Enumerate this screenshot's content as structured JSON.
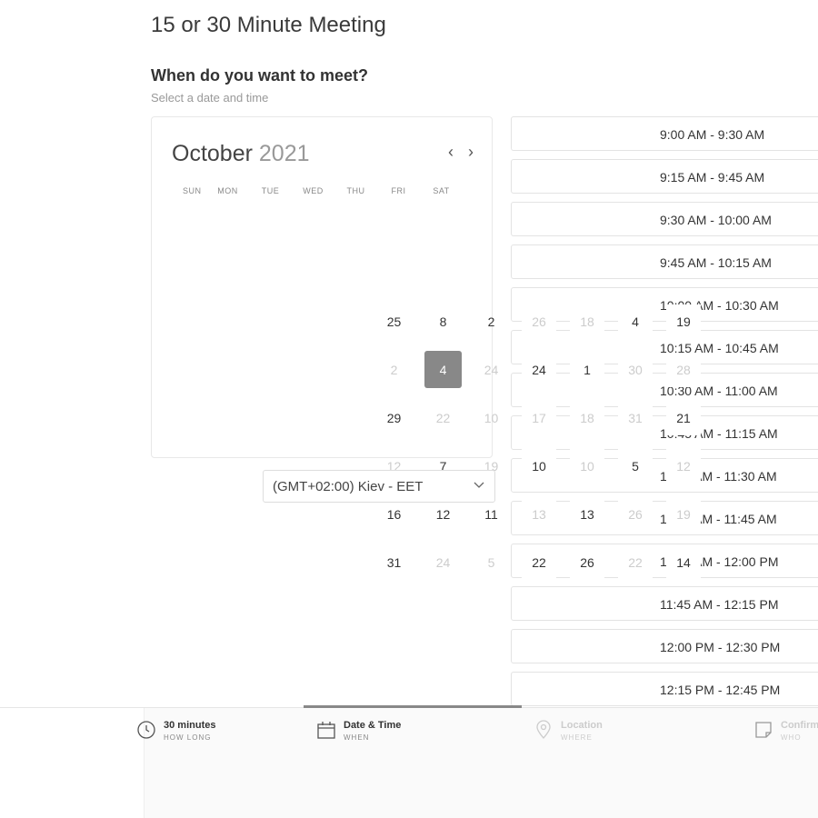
{
  "page": {
    "title": "15 or 30 Minute Meeting",
    "question": "When do you want to meet?",
    "subtitle": "Select a date and time"
  },
  "calendar": {
    "month": "October",
    "year": "2021",
    "prev_label": "‹",
    "next_label": "›",
    "weekdays": [
      "SUN",
      "MON",
      "TUE",
      "WED",
      "THU",
      "FRI",
      "SAT"
    ],
    "visible_days": [
      {
        "text": "25",
        "muted": false
      },
      {
        "text": "8",
        "muted": false
      },
      {
        "text": "2",
        "muted": false
      },
      {
        "text": "2",
        "muted": true
      },
      {
        "text": "4",
        "muted": false,
        "selected": true
      },
      {
        "text": "24",
        "muted": true
      },
      {
        "text": "29",
        "muted": false
      },
      {
        "text": "22",
        "muted": true
      },
      {
        "text": "10",
        "muted": true
      },
      {
        "text": "12",
        "muted": true
      },
      {
        "text": "7",
        "muted": false
      },
      {
        "text": "19",
        "muted": true
      },
      {
        "text": "16",
        "muted": false
      },
      {
        "text": "12",
        "muted": false
      },
      {
        "text": "11",
        "muted": false
      },
      {
        "text": "31",
        "muted": false
      },
      {
        "text": "24",
        "muted": true
      },
      {
        "text": "5",
        "muted": true
      }
    ],
    "overflow_days": [
      "26",
      "18",
      "4",
      "19",
      "24",
      "1",
      "30",
      "28",
      "17",
      "18",
      "31",
      "21",
      "10",
      "10",
      "5",
      "12",
      "13",
      "13",
      "26",
      "19",
      "22",
      "26",
      "22",
      "14"
    ]
  },
  "timezone": {
    "value": "(GMT+02:00) Kiev - EET",
    "chevron_icon": "chevron-down-icon"
  },
  "slots": [
    "9:00 AM - 9:30 AM",
    "9:15 AM - 9:45 AM",
    "9:30 AM - 10:00 AM",
    "9:45 AM - 10:15 AM",
    "10:00 AM - 10:30 AM",
    "10:15 AM - 10:45 AM",
    "10:30 AM - 11:00 AM",
    "10:45 AM - 11:15 AM",
    "11:00 AM - 11:30 AM",
    "11:15 AM - 11:45 AM",
    "11:30 AM - 12:00 PM",
    "11:45 AM - 12:15 PM",
    "12:00 PM - 12:30 PM",
    "12:15 PM - 12:45 PM"
  ],
  "steps": [
    {
      "label": "30 minutes",
      "caption": "HOW LONG",
      "icon": "clock-icon"
    },
    {
      "label": "Date & Time",
      "caption": "WHEN",
      "icon": "calendar-icon"
    },
    {
      "label": "Location",
      "caption": "WHERE",
      "icon": "location-pin-icon"
    },
    {
      "label": "Confirm",
      "caption": "WHO",
      "icon": "note-icon"
    }
  ],
  "colors": {
    "selected_day": "#888888",
    "accent_bar": "#888888"
  }
}
